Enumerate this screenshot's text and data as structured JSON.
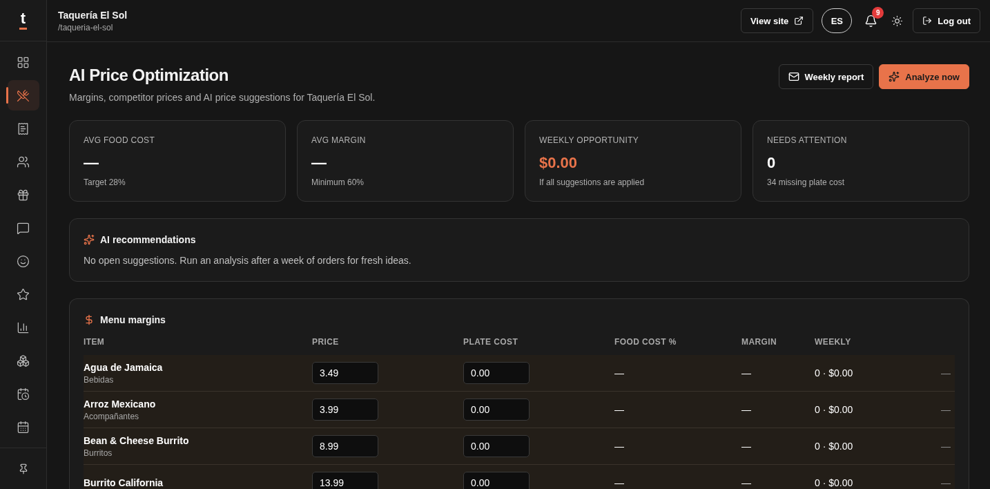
{
  "sidebar": {
    "logo": "t",
    "items": [
      {
        "selected": false
      },
      {
        "selected": true
      },
      {
        "selected": false
      },
      {
        "selected": false
      },
      {
        "selected": false
      },
      {
        "selected": false
      },
      {
        "selected": false
      },
      {
        "selected": false
      },
      {
        "selected": false
      },
      {
        "selected": false
      },
      {
        "selected": false
      },
      {
        "selected": false
      }
    ]
  },
  "header": {
    "restaurant": "Taquería El Sol",
    "slug": "/taqueria-el-sol",
    "view_site": "View site",
    "language": "ES",
    "notifications": "9",
    "logout": "Log out"
  },
  "page": {
    "title": "AI Price Optimization",
    "subtitle": "Margins, competitor prices and AI price suggestions for Taquería El Sol.",
    "buttons": [
      {
        "kind": "outline",
        "label": "Weekly report"
      },
      {
        "kind": "primary",
        "label": "Analyze now"
      }
    ]
  },
  "stats": [
    {
      "label": "AVG FOOD COST",
      "value": "—",
      "note": "Target 28%",
      "highlight": false
    },
    {
      "label": "AVG MARGIN",
      "value": "—",
      "note": "Minimum 60%",
      "highlight": false
    },
    {
      "label": "WEEKLY OPPORTUNITY",
      "value": "$0.00",
      "note": "If all suggestions are applied",
      "highlight": true
    },
    {
      "label": "NEEDS ATTENTION",
      "value": "0",
      "note": "34 missing plate cost",
      "highlight": false
    }
  ],
  "recommendations": {
    "title": "AI recommendations",
    "message": "No open suggestions. Run an analysis after a week of orders for fresh ideas."
  },
  "table": {
    "title": "Menu margins",
    "columns": [
      "ITEM",
      "PRICE",
      "PLATE COST",
      "FOOD COST %",
      "MARGIN",
      "WEEKLY"
    ],
    "rows": [
      {
        "name": "Agua de Jamaica",
        "category": "Bebidas",
        "price": "3.49",
        "plate_cost": "0.00",
        "food_cost": "—",
        "margin": "—",
        "weekly": "0 · $0.00",
        "column_7": "—"
      },
      {
        "name": "Arroz Mexicano",
        "category": "Acompañantes",
        "price": "3.99",
        "plate_cost": "0.00",
        "food_cost": "—",
        "margin": "—",
        "weekly": "0 · $0.00",
        "column_7": "—"
      },
      {
        "name": "Bean & Cheese Burrito",
        "category": "Burritos",
        "price": "8.99",
        "plate_cost": "0.00",
        "food_cost": "—",
        "margin": "—",
        "weekly": "0 · $0.00",
        "column_7": "—"
      },
      {
        "name": "Burrito California",
        "price": "13.99",
        "plate_cost": "0.00",
        "food_cost": "—",
        "margin": "—",
        "weekly": "0 · $0.00",
        "column_7": "—"
      }
    ]
  }
}
